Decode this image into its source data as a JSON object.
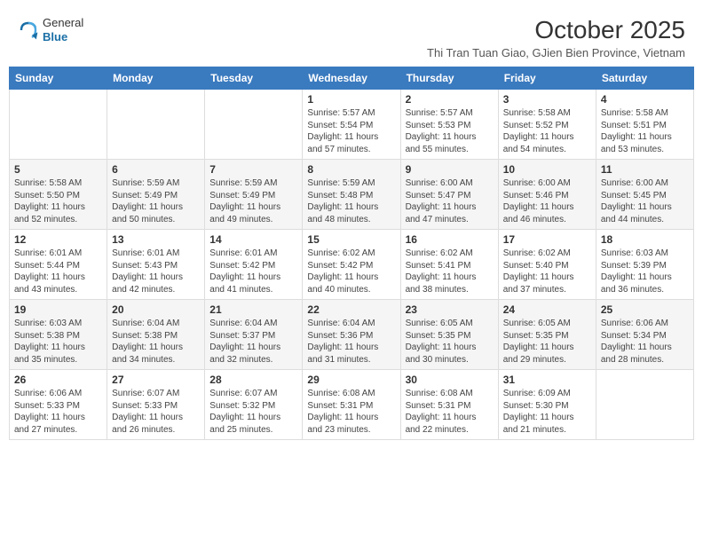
{
  "header": {
    "logo_general": "General",
    "logo_blue": "Blue",
    "month": "October 2025",
    "location": "Thi Tran Tuan Giao, GJien Bien Province, Vietnam"
  },
  "weekdays": [
    "Sunday",
    "Monday",
    "Tuesday",
    "Wednesday",
    "Thursday",
    "Friday",
    "Saturday"
  ],
  "weeks": [
    [
      {
        "day": "",
        "sunrise": "",
        "sunset": "",
        "daylight": ""
      },
      {
        "day": "",
        "sunrise": "",
        "sunset": "",
        "daylight": ""
      },
      {
        "day": "",
        "sunrise": "",
        "sunset": "",
        "daylight": ""
      },
      {
        "day": "1",
        "sunrise": "Sunrise: 5:57 AM",
        "sunset": "Sunset: 5:54 PM",
        "daylight": "Daylight: 11 hours and 57 minutes."
      },
      {
        "day": "2",
        "sunrise": "Sunrise: 5:57 AM",
        "sunset": "Sunset: 5:53 PM",
        "daylight": "Daylight: 11 hours and 55 minutes."
      },
      {
        "day": "3",
        "sunrise": "Sunrise: 5:58 AM",
        "sunset": "Sunset: 5:52 PM",
        "daylight": "Daylight: 11 hours and 54 minutes."
      },
      {
        "day": "4",
        "sunrise": "Sunrise: 5:58 AM",
        "sunset": "Sunset: 5:51 PM",
        "daylight": "Daylight: 11 hours and 53 minutes."
      }
    ],
    [
      {
        "day": "5",
        "sunrise": "Sunrise: 5:58 AM",
        "sunset": "Sunset: 5:50 PM",
        "daylight": "Daylight: 11 hours and 52 minutes."
      },
      {
        "day": "6",
        "sunrise": "Sunrise: 5:59 AM",
        "sunset": "Sunset: 5:49 PM",
        "daylight": "Daylight: 11 hours and 50 minutes."
      },
      {
        "day": "7",
        "sunrise": "Sunrise: 5:59 AM",
        "sunset": "Sunset: 5:49 PM",
        "daylight": "Daylight: 11 hours and 49 minutes."
      },
      {
        "day": "8",
        "sunrise": "Sunrise: 5:59 AM",
        "sunset": "Sunset: 5:48 PM",
        "daylight": "Daylight: 11 hours and 48 minutes."
      },
      {
        "day": "9",
        "sunrise": "Sunrise: 6:00 AM",
        "sunset": "Sunset: 5:47 PM",
        "daylight": "Daylight: 11 hours and 47 minutes."
      },
      {
        "day": "10",
        "sunrise": "Sunrise: 6:00 AM",
        "sunset": "Sunset: 5:46 PM",
        "daylight": "Daylight: 11 hours and 46 minutes."
      },
      {
        "day": "11",
        "sunrise": "Sunrise: 6:00 AM",
        "sunset": "Sunset: 5:45 PM",
        "daylight": "Daylight: 11 hours and 44 minutes."
      }
    ],
    [
      {
        "day": "12",
        "sunrise": "Sunrise: 6:01 AM",
        "sunset": "Sunset: 5:44 PM",
        "daylight": "Daylight: 11 hours and 43 minutes."
      },
      {
        "day": "13",
        "sunrise": "Sunrise: 6:01 AM",
        "sunset": "Sunset: 5:43 PM",
        "daylight": "Daylight: 11 hours and 42 minutes."
      },
      {
        "day": "14",
        "sunrise": "Sunrise: 6:01 AM",
        "sunset": "Sunset: 5:42 PM",
        "daylight": "Daylight: 11 hours and 41 minutes."
      },
      {
        "day": "15",
        "sunrise": "Sunrise: 6:02 AM",
        "sunset": "Sunset: 5:42 PM",
        "daylight": "Daylight: 11 hours and 40 minutes."
      },
      {
        "day": "16",
        "sunrise": "Sunrise: 6:02 AM",
        "sunset": "Sunset: 5:41 PM",
        "daylight": "Daylight: 11 hours and 38 minutes."
      },
      {
        "day": "17",
        "sunrise": "Sunrise: 6:02 AM",
        "sunset": "Sunset: 5:40 PM",
        "daylight": "Daylight: 11 hours and 37 minutes."
      },
      {
        "day": "18",
        "sunrise": "Sunrise: 6:03 AM",
        "sunset": "Sunset: 5:39 PM",
        "daylight": "Daylight: 11 hours and 36 minutes."
      }
    ],
    [
      {
        "day": "19",
        "sunrise": "Sunrise: 6:03 AM",
        "sunset": "Sunset: 5:38 PM",
        "daylight": "Daylight: 11 hours and 35 minutes."
      },
      {
        "day": "20",
        "sunrise": "Sunrise: 6:04 AM",
        "sunset": "Sunset: 5:38 PM",
        "daylight": "Daylight: 11 hours and 34 minutes."
      },
      {
        "day": "21",
        "sunrise": "Sunrise: 6:04 AM",
        "sunset": "Sunset: 5:37 PM",
        "daylight": "Daylight: 11 hours and 32 minutes."
      },
      {
        "day": "22",
        "sunrise": "Sunrise: 6:04 AM",
        "sunset": "Sunset: 5:36 PM",
        "daylight": "Daylight: 11 hours and 31 minutes."
      },
      {
        "day": "23",
        "sunrise": "Sunrise: 6:05 AM",
        "sunset": "Sunset: 5:35 PM",
        "daylight": "Daylight: 11 hours and 30 minutes."
      },
      {
        "day": "24",
        "sunrise": "Sunrise: 6:05 AM",
        "sunset": "Sunset: 5:35 PM",
        "daylight": "Daylight: 11 hours and 29 minutes."
      },
      {
        "day": "25",
        "sunrise": "Sunrise: 6:06 AM",
        "sunset": "Sunset: 5:34 PM",
        "daylight": "Daylight: 11 hours and 28 minutes."
      }
    ],
    [
      {
        "day": "26",
        "sunrise": "Sunrise: 6:06 AM",
        "sunset": "Sunset: 5:33 PM",
        "daylight": "Daylight: 11 hours and 27 minutes."
      },
      {
        "day": "27",
        "sunrise": "Sunrise: 6:07 AM",
        "sunset": "Sunset: 5:33 PM",
        "daylight": "Daylight: 11 hours and 26 minutes."
      },
      {
        "day": "28",
        "sunrise": "Sunrise: 6:07 AM",
        "sunset": "Sunset: 5:32 PM",
        "daylight": "Daylight: 11 hours and 25 minutes."
      },
      {
        "day": "29",
        "sunrise": "Sunrise: 6:08 AM",
        "sunset": "Sunset: 5:31 PM",
        "daylight": "Daylight: 11 hours and 23 minutes."
      },
      {
        "day": "30",
        "sunrise": "Sunrise: 6:08 AM",
        "sunset": "Sunset: 5:31 PM",
        "daylight": "Daylight: 11 hours and 22 minutes."
      },
      {
        "day": "31",
        "sunrise": "Sunrise: 6:09 AM",
        "sunset": "Sunset: 5:30 PM",
        "daylight": "Daylight: 11 hours and 21 minutes."
      },
      {
        "day": "",
        "sunrise": "",
        "sunset": "",
        "daylight": ""
      }
    ]
  ]
}
